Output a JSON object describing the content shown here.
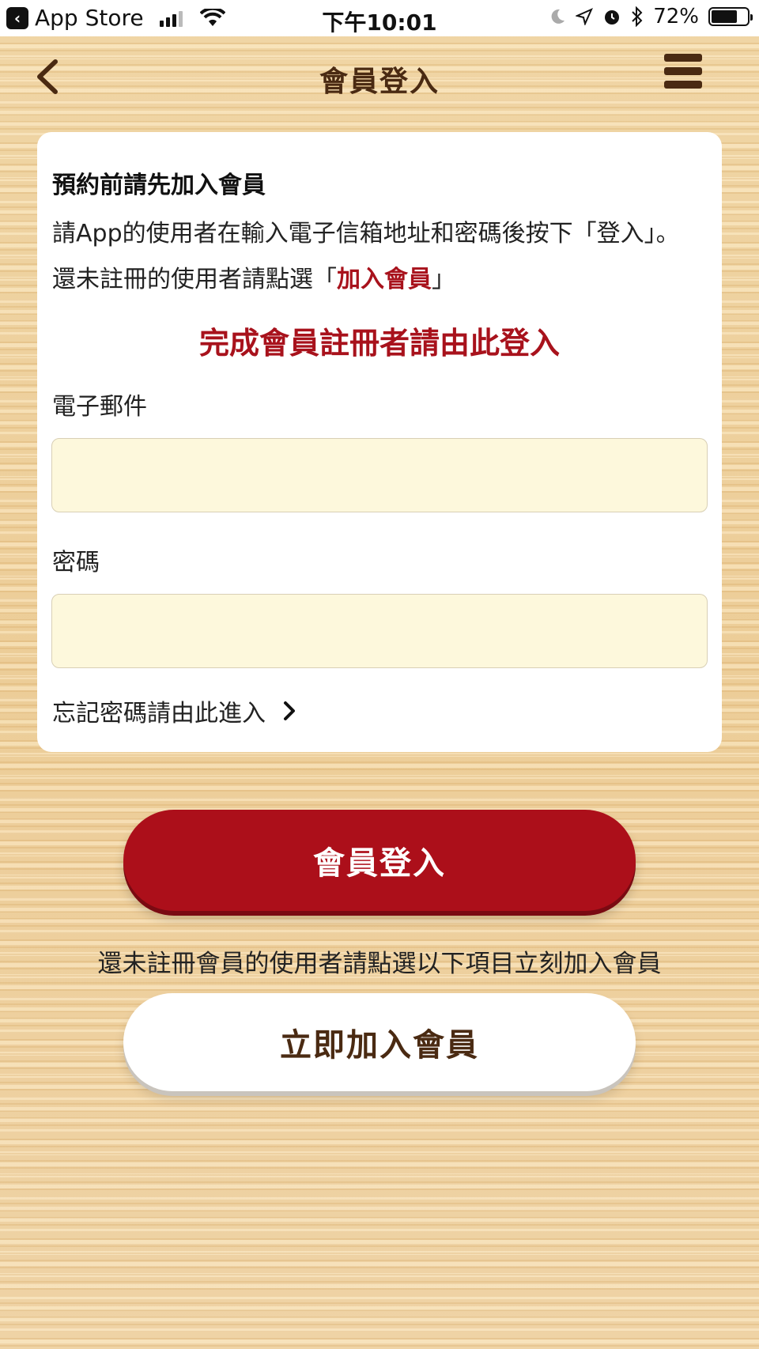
{
  "status_bar": {
    "back_app": "App Store",
    "time": "下午10:01",
    "battery": "72%",
    "battery_level": 0.72
  },
  "nav": {
    "title": "會員登入",
    "back_icon": "chevron-left-icon",
    "menu_icon": "hamburger-menu-icon"
  },
  "card": {
    "heading": "預約前請先加入會員",
    "desc_prefix": "請App的使用者在輸入電子信箱地址和密碼後按下「登入」。還未註冊的使用者請點選「",
    "desc_link": "加入會員",
    "desc_suffix": "」",
    "notice": "完成會員註冊者請由此登入",
    "email_label": "電子郵件",
    "email_value": "",
    "password_label": "密碼",
    "password_value": "",
    "forgot_label": "忘記密碼請由此進入"
  },
  "login_button": "會員登入",
  "signup_hint": "還未註冊會員的使用者請點選以下項目立刻加入會員",
  "join_button": "立即加入會員",
  "colors": {
    "accent_red": "#a8121c",
    "brown": "#4a2a12",
    "input_bg": "#fdf8dc"
  }
}
